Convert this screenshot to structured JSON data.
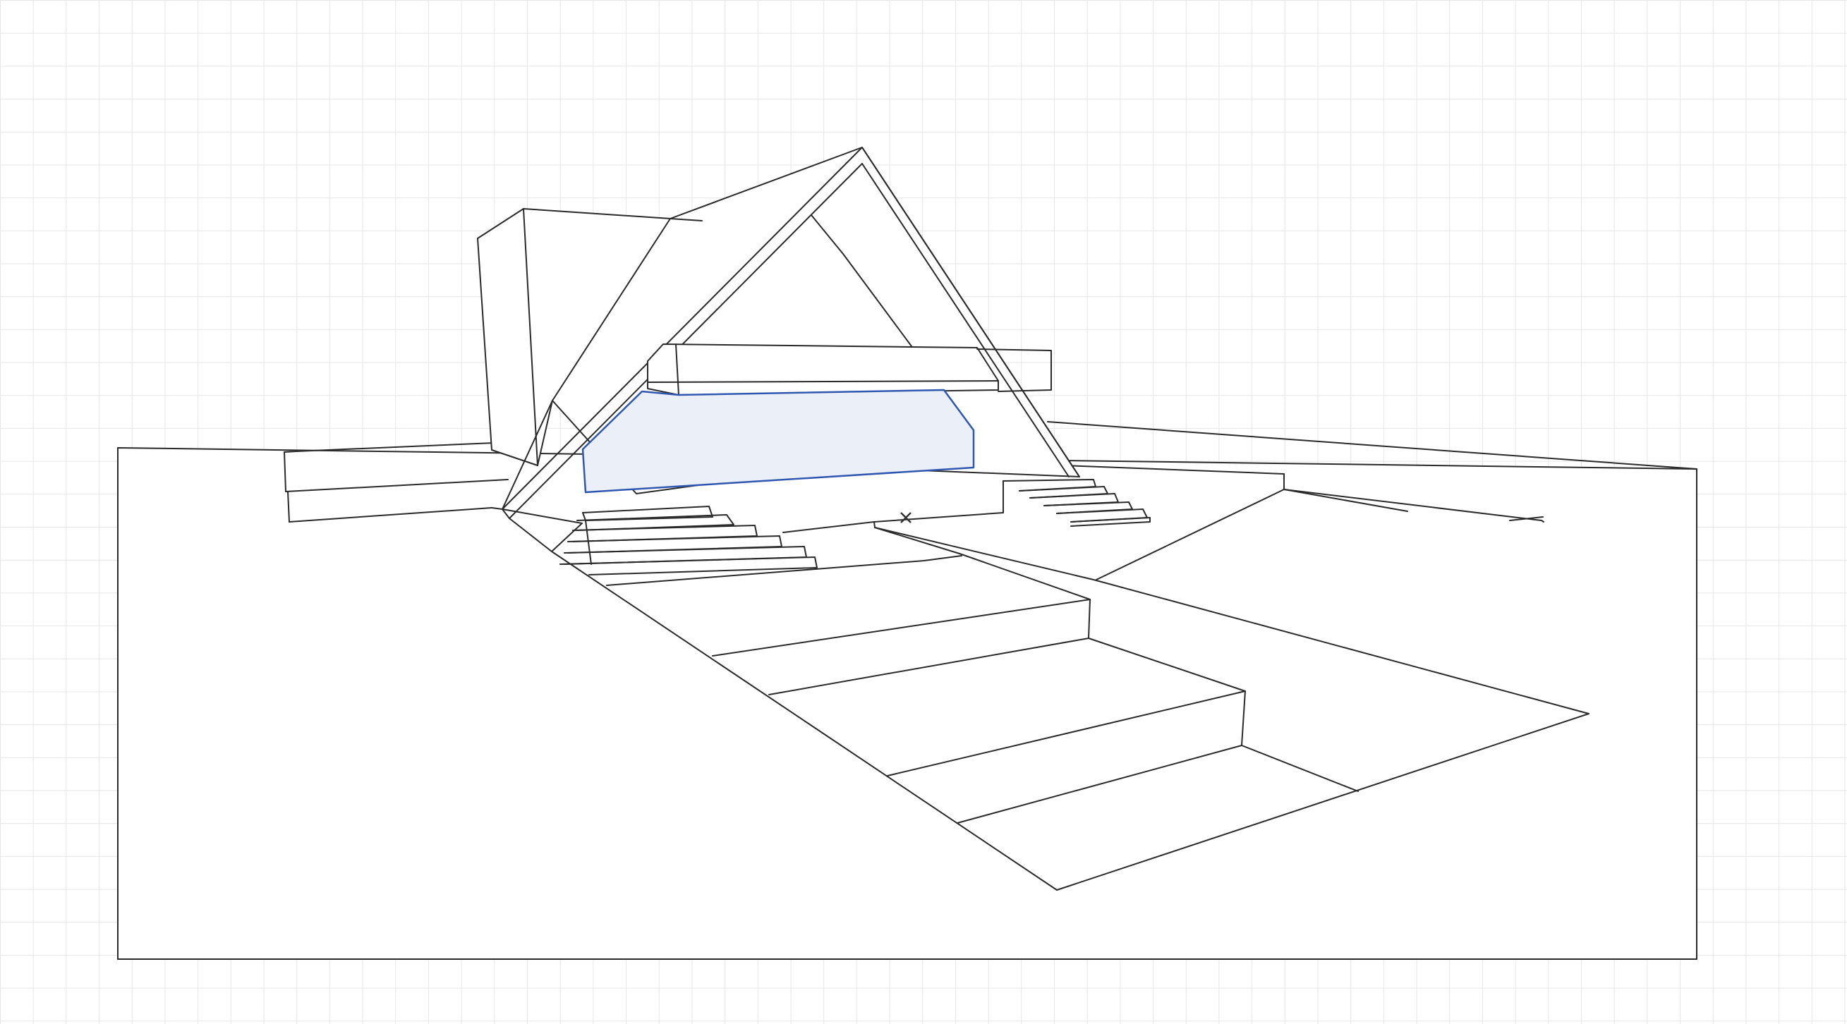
{
  "app": {
    "view": "perspective-sketch"
  },
  "canvas": {
    "background": "#ffffff",
    "grid_color": "#e6e6e6",
    "grid": true
  },
  "selection": {
    "fill": "#eaeff8",
    "stroke": "#2f57b0"
  },
  "cursor": {
    "icon": "cross-cursor-icon"
  }
}
